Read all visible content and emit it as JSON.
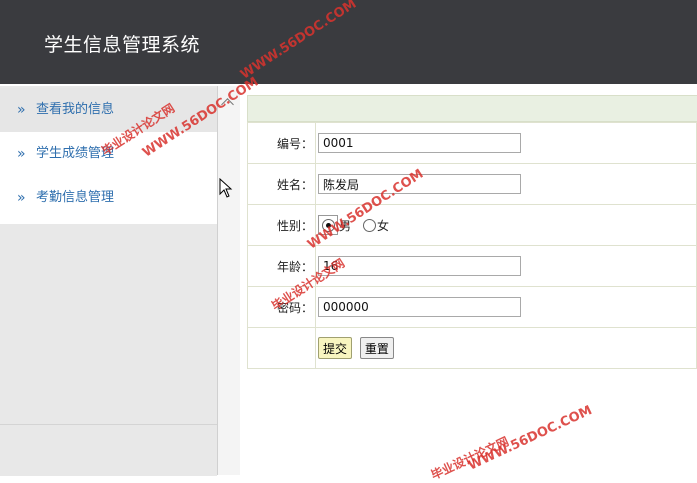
{
  "header": {
    "title": "学生信息管理系统"
  },
  "sidebar": {
    "items": [
      {
        "chevron": "»",
        "label": "查看我的信息",
        "active": true
      },
      {
        "chevron": "»",
        "label": "学生成绩管理",
        "active": false
      },
      {
        "chevron": "»",
        "label": "考勤信息管理",
        "active": false
      }
    ]
  },
  "form": {
    "id_label": "编号：",
    "id_value": "0001",
    "name_label": "姓名：",
    "name_value": "陈发局",
    "gender_label": "性别：",
    "gender_male": "男",
    "gender_female": "女",
    "gender_selected": "男",
    "age_label": "年龄：",
    "age_value": "16",
    "password_label": "密码：",
    "password_value": "000000",
    "submit_label": "提交",
    "reset_label": "重置"
  },
  "watermarks": {
    "site": "WWW.56DOC.COM",
    "brand": "毕业设计论文网"
  },
  "icons": {
    "collapse": "chevron-up-icon",
    "cursor": "mouse-pointer-icon",
    "nav": "double-chevron-right-icon"
  }
}
